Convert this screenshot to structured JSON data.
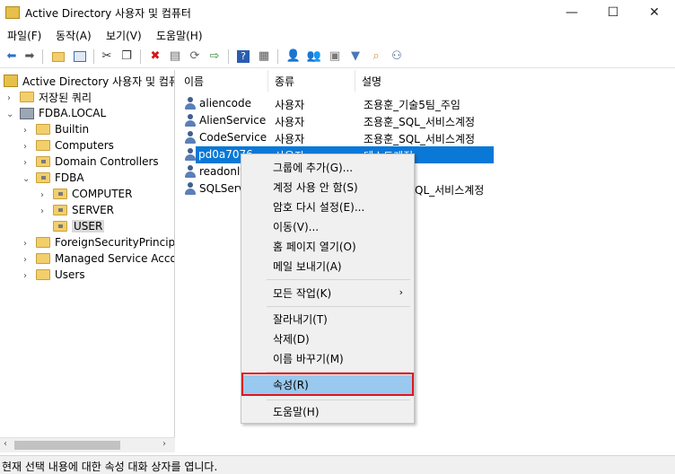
{
  "window": {
    "title": "Active Directory 사용자 및 컴퓨터",
    "minimize": "—",
    "maximize": "☐",
    "close": "✕"
  },
  "menu": [
    "파일(F)",
    "동작(A)",
    "보기(V)",
    "도움말(H)"
  ],
  "toolbar_icons": [
    "back-arrow",
    "forward-arrow",
    "folder-up",
    "show-hide-console-tree",
    "cut",
    "copy",
    "delete",
    "properties",
    "refresh",
    "export-list",
    "help",
    "show-hide-action-pane",
    "add-users",
    "add-group",
    "add-ou",
    "filter",
    "find",
    "add-to-group"
  ],
  "tree": {
    "root": "Active Directory 사용자 및 컴퓨터",
    "saved_queries": "저장된 쿼리",
    "domain": "FDBA.LOCAL",
    "builtin": "Builtin",
    "computers": "Computers",
    "domain_controllers": "Domain Controllers",
    "fdba": "FDBA",
    "computer_ou": "COMPUTER",
    "server_ou": "SERVER",
    "user_ou": "USER",
    "fsp": "ForeignSecurityPrincipal",
    "msa": "Managed Service Accou",
    "users": "Users"
  },
  "columns": {
    "name": "이름",
    "type": "종류",
    "description": "설명"
  },
  "rows": [
    {
      "name": "aliencode",
      "type": "사용자",
      "description": "조용훈_기술5팀_주임"
    },
    {
      "name": "AlienService",
      "type": "사용자",
      "description": "조용훈_SQL_서비스계정"
    },
    {
      "name": "CodeService",
      "type": "사용자",
      "description": "조용훈_SQL_서비스계정"
    },
    {
      "name": "pd0a7076",
      "type": "사용자",
      "description": "테스트계정"
    },
    {
      "name": "readonly",
      "type": "",
      "description": ""
    },
    {
      "name": "SQLServi",
      "type": "",
      "description": "QL_서비스계정"
    }
  ],
  "context_menu": {
    "add_to_group": "그룹에 추가(G)...",
    "disable_account": "계정 사용 안 함(S)",
    "reset_password": "암호 다시 설정(E)...",
    "move": "이동(V)...",
    "open_home_page": "홈 페이지 열기(O)",
    "send_mail": "메일 보내기(A)",
    "all_tasks": "모든 작업(K)",
    "cut": "잘라내기(T)",
    "delete": "삭제(D)",
    "rename": "이름 바꾸기(M)",
    "properties": "속성(R)",
    "help": "도움말(H)"
  },
  "status": "현재 선택 내용에 대한 속성 대화 상자를 엽니다.",
  "colors": {
    "selection": "#0a78d7",
    "menu_highlight": "#99c9ef",
    "annotation_box": "#e2141c"
  }
}
